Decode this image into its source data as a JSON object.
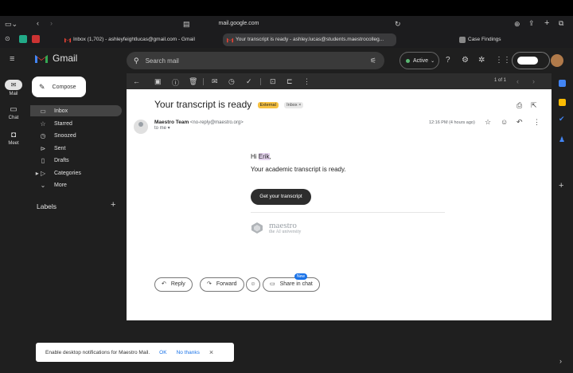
{
  "browser": {
    "url": "mail.google.com",
    "tabs": [
      {
        "label": "Inbox (1,702) - ashleyfeightlucas@gmail.com - Gmail"
      },
      {
        "label": "Your transcript is ready - ashley.lucas@students.maestrocolleg..."
      },
      {
        "label": "Case Findings"
      }
    ]
  },
  "gmail": {
    "logo": "Gmail",
    "search_placeholder": "Search mail",
    "status": "Active",
    "rail": [
      {
        "label": "Mail"
      },
      {
        "label": "Chat"
      },
      {
        "label": "Meet"
      }
    ],
    "compose": "Compose",
    "nav": [
      {
        "label": "Inbox"
      },
      {
        "label": "Starred"
      },
      {
        "label": "Snoozed"
      },
      {
        "label": "Sent"
      },
      {
        "label": "Drafts"
      },
      {
        "label": "Categories"
      },
      {
        "label": "More"
      }
    ],
    "labels_header": "Labels"
  },
  "message": {
    "counter": "1 of 1",
    "subject": "Your transcript is ready",
    "badge_external": "External",
    "badge_inbox": "Inbox ×",
    "sender_name": "Maestro Team",
    "sender_email": "<no-reply@maestro.org>",
    "to": "to me ▾",
    "time": "12:16 PM (4 hours ago)",
    "greeting_prefix": "Hi ",
    "greeting_name": "Erik",
    "greeting_suffix": ",",
    "body": "Your academic transcript is ready.",
    "cta": "Get your transcript",
    "brand_name": "maestro",
    "brand_tagline": "the AI university",
    "reply": "Reply",
    "forward": "Forward",
    "share": "Share in chat",
    "share_badge": "New"
  },
  "toast": {
    "text": "Enable desktop notifications for Maestro Mail.",
    "ok": "OK",
    "no_thanks": "No thanks"
  }
}
